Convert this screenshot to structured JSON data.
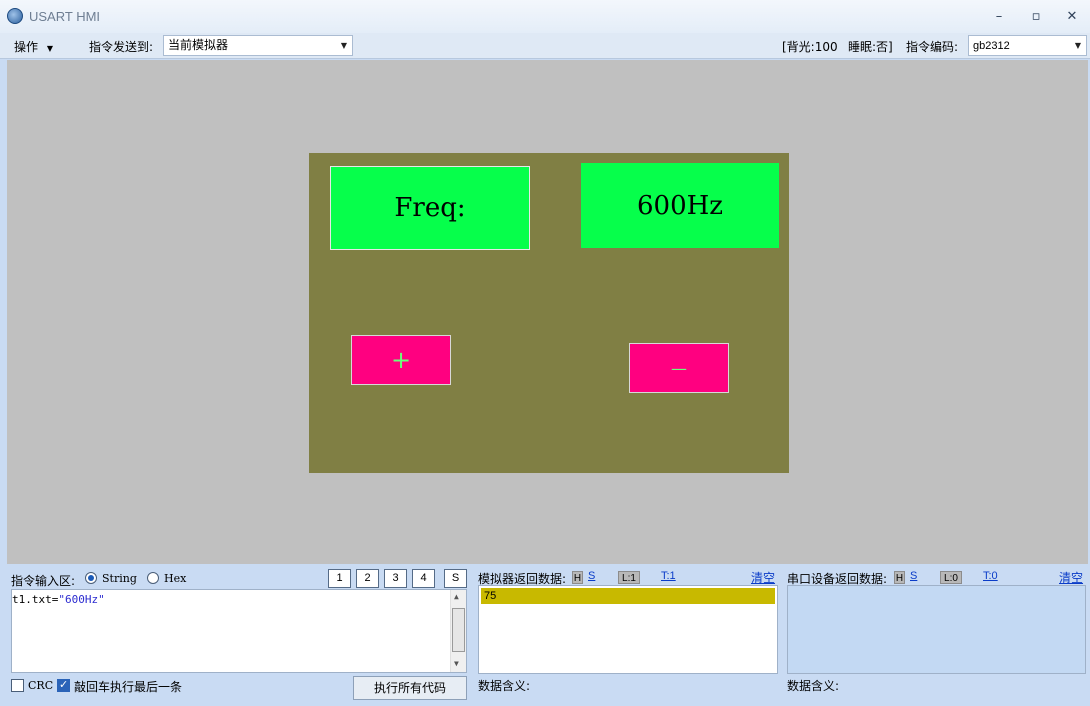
{
  "window": {
    "title": "USART HMI",
    "minimize": "–",
    "maximize": "▫",
    "close": "✕"
  },
  "toolbar": {
    "menu_label": "操作",
    "send_to_label": "指令发送到:",
    "send_to_value": "当前模拟器",
    "backlight": "[背光:100",
    "sleep": "睡眠:否]",
    "encoding_label": "指令编码:",
    "encoding_value": "gb2312"
  },
  "simulator": {
    "label_text": "Freq:",
    "value_text": "600Hz",
    "plus_button": "+",
    "minus_button": "—",
    "colors": {
      "background": "#807f44",
      "text_box": "#06ff4b",
      "button": "#ff0080",
      "button_text": "#6aff7a"
    }
  },
  "command_panel": {
    "input_label": "指令输入区:",
    "mode_string": "String",
    "mode_hex": "Hex",
    "selected_mode": "String",
    "quick_buttons": [
      "1",
      "2",
      "3",
      "4",
      "S"
    ],
    "input_code_prefix": "t1.txt=",
    "input_code_string": "\"600Hz\"",
    "crc_label": "CRC",
    "crc_checked": false,
    "enter_exec_label": "敲回车执行最后一条",
    "enter_exec_checked": true,
    "execute_all_button": "执行所有代码"
  },
  "sim_return": {
    "label": "模拟器返回数据:",
    "h": "H",
    "s": "S",
    "l": "L:1",
    "t": "T:1",
    "clear": "清空",
    "rows": [
      "75"
    ],
    "meaning_label": "数据含义:"
  },
  "serial_return": {
    "label": "串口设备返回数据:",
    "h": "H",
    "s": "S",
    "l": "L:0",
    "t": "T:0",
    "clear": "清空",
    "meaning_label": "数据含义:"
  }
}
